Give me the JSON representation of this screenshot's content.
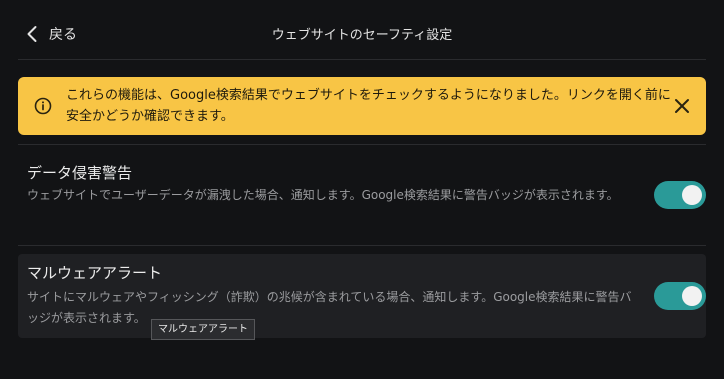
{
  "header": {
    "back_label": "戻る",
    "title": "ウェブサイトのセーフティ設定"
  },
  "banner": {
    "text": "これらの機能は、Google検索結果でウェブサイトをチェックするようになりました。リンクを開く前に安全かどうか確認できます。",
    "icon": "info-icon",
    "close_icon": "close-icon",
    "color": "#f8c545"
  },
  "settings": [
    {
      "title": "データ侵害警告",
      "description": "ウェブサイトでユーザーデータが漏洩した場合、通知します。Google検索結果に警告バッジが表示されます。",
      "enabled": true
    },
    {
      "title": "マルウェアアラート",
      "description": "サイトにマルウェアやフィッシング（詐欺）の兆候が含まれている場合、通知します。Google検索結果に警告バッジが表示されます。",
      "enabled": true
    }
  ],
  "tooltip": {
    "text": "マルウェアアラート"
  },
  "colors": {
    "accent": "#2a9a98",
    "background": "#121315",
    "banner": "#f8c545"
  }
}
